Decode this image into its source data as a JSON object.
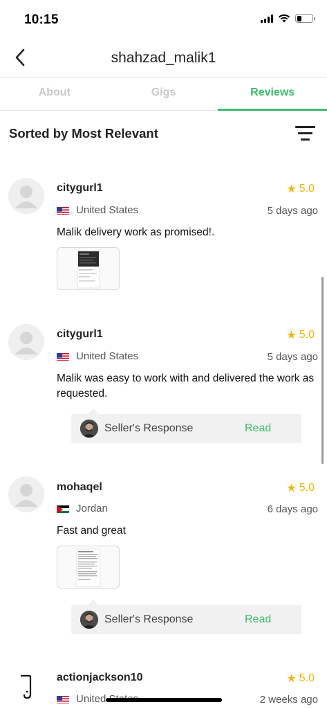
{
  "status_bar": {
    "time": "10:15"
  },
  "header": {
    "title": "shahzad_malik1"
  },
  "tabs": [
    {
      "label": "About",
      "active": false
    },
    {
      "label": "Gigs",
      "active": false
    },
    {
      "label": "Reviews",
      "active": true
    }
  ],
  "sort": {
    "label": "Sorted by Most Relevant"
  },
  "reviews": [
    {
      "name": "citygurl1",
      "rating": "5.0",
      "country": "United States",
      "date": "5 days ago",
      "text": "Malik delivery work as promised!."
    },
    {
      "name": "citygurl1",
      "rating": "5.0",
      "country": "United States",
      "date": "5 days ago",
      "text": "Malik was easy to work with and delivered the work as requested.",
      "seller_response": {
        "label": "Seller's Response",
        "action": "Read"
      }
    },
    {
      "name": "mohaqel",
      "rating": "5.0",
      "country": "Jordan",
      "date": "6 days ago",
      "text": "Fast and great",
      "seller_response": {
        "label": "Seller's Response",
        "action": "Read"
      }
    },
    {
      "name": "actionjackson10",
      "rating": "5.0",
      "country": "United States",
      "date": "2 weeks ago"
    }
  ],
  "colors": {
    "accent": "#3dbb6b",
    "star": "#f5b400"
  }
}
